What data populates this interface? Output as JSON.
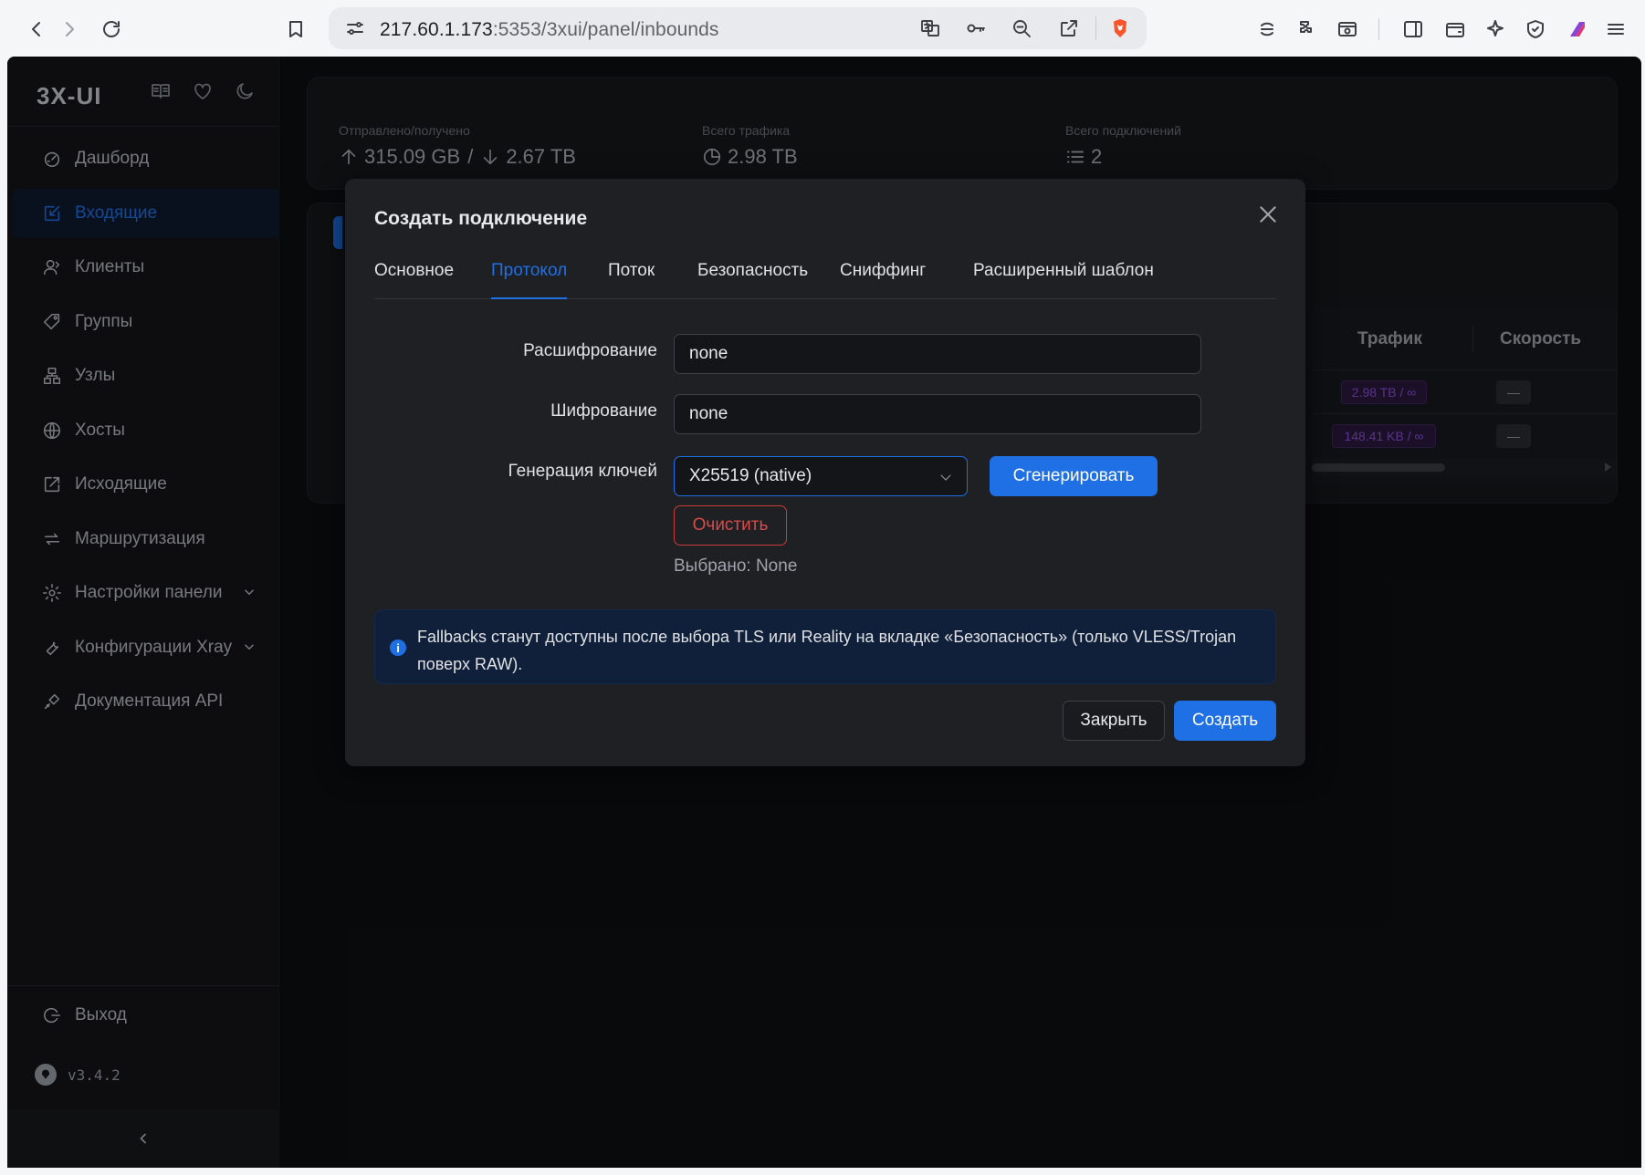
{
  "browser": {
    "url_host": "217.60.1.173",
    "url_rest": ":5353/3xui/panel/inbounds",
    "brand_color": "#fb542b"
  },
  "sidebar": {
    "brand": "3X-UI",
    "items": [
      {
        "label": "Дашборд",
        "icon": "dashboard-icon"
      },
      {
        "label": "Входящие",
        "icon": "inbound-icon",
        "active": true
      },
      {
        "label": "Клиенты",
        "icon": "clients-icon"
      },
      {
        "label": "Группы",
        "icon": "tag-icon"
      },
      {
        "label": "Узлы",
        "icon": "nodes-icon"
      },
      {
        "label": "Хосты",
        "icon": "globe-icon"
      },
      {
        "label": "Исходящие",
        "icon": "outbound-icon"
      },
      {
        "label": "Маршрутизация",
        "icon": "routing-icon"
      },
      {
        "label": "Настройки панели",
        "icon": "gear-icon",
        "expandable": true
      },
      {
        "label": "Конфигурации Xray",
        "icon": "tool-icon",
        "expandable": true
      },
      {
        "label": "Документация API",
        "icon": "api-icon"
      }
    ],
    "logout_label": "Выход",
    "version": "v3.4.2"
  },
  "stats": {
    "sent_received_label": "Отправлено/получено",
    "sent": "315.09 GB",
    "received": "2.67 TB",
    "total_traffic_label": "Всего трафика",
    "total_traffic": "2.98 TB",
    "total_connections_label": "Всего подключений",
    "total_connections": "2"
  },
  "table": {
    "col_traffic": "Трафик",
    "col_speed": "Скорость",
    "rows": [
      {
        "traffic": "2.98 TB / ∞",
        "speed": "—"
      },
      {
        "traffic": "148.41 KB / ∞",
        "speed": "—"
      }
    ]
  },
  "modal": {
    "title": "Создать подключение",
    "tabs": [
      "Основное",
      "Протокол",
      "Поток",
      "Безопасность",
      "Сниффинг",
      "Расширенный шаблон"
    ],
    "active_tab": "Протокол",
    "decryption_label": "Расшифрование",
    "decryption_value": "none",
    "encryption_label": "Шифрование",
    "encryption_value": "none",
    "keygen_label": "Генерация ключей",
    "keygen_value": "X25519 (native)",
    "generate_button": "Сгенерировать",
    "clear_button": "Очистить",
    "selected_text": "Выбрано: None",
    "info_text": "Fallbacks станут доступны после выбора TLS или Reality на вкладке «Безопасность» (только VLESS/Trojan поверх RAW).",
    "close_button": "Закрыть",
    "create_button": "Создать"
  }
}
